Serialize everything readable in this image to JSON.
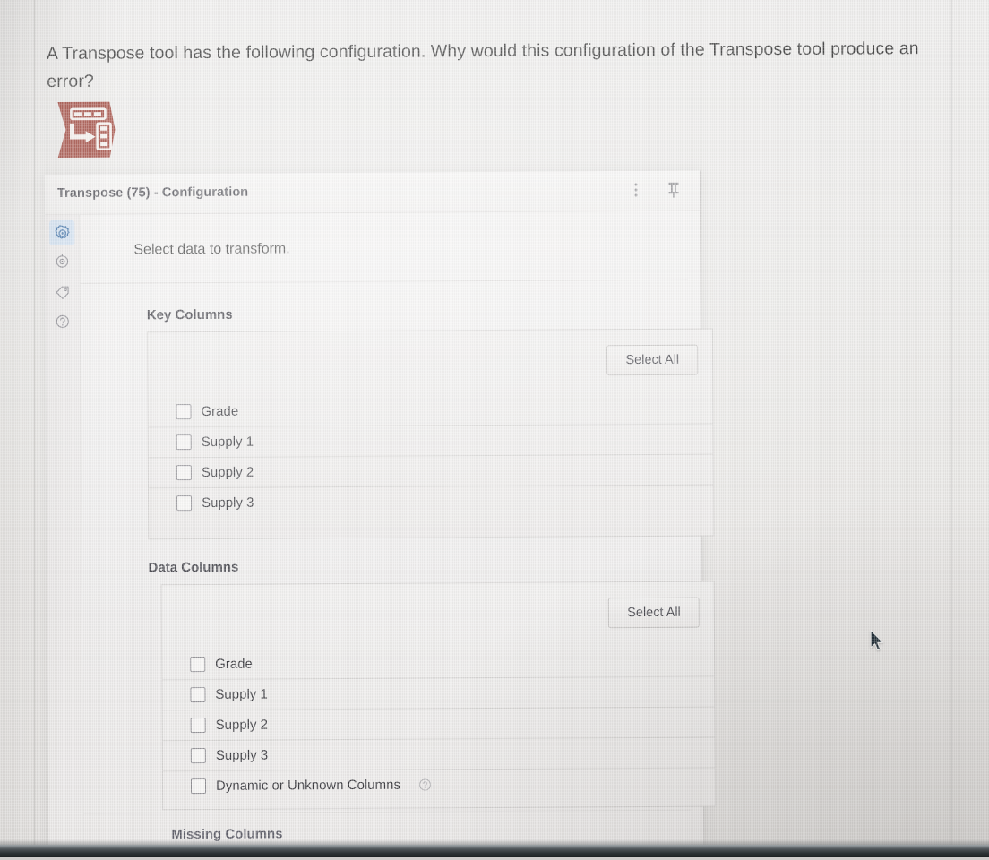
{
  "question": {
    "text": "A Transpose tool has the following configuration. Why would this configuration of the Transpose tool produce an error?"
  },
  "tool_icon": {
    "name": "transpose-tool-icon",
    "color": "#a0463c"
  },
  "panel": {
    "title": "Transpose (75) - Configuration",
    "header_actions": [
      {
        "name": "more-options-icon",
        "label": "⋮"
      },
      {
        "name": "pin-icon",
        "label": "📌"
      }
    ],
    "rail_items": [
      {
        "name": "configuration-gear-icon",
        "label": "Configuration",
        "active": true
      },
      {
        "name": "annotation-target-icon",
        "label": "Annotation",
        "active": false
      },
      {
        "name": "tag-icon",
        "label": "Tag",
        "active": false
      },
      {
        "name": "help-icon",
        "label": "Help",
        "active": false
      }
    ],
    "intro": "Select data to transform.",
    "key_columns": {
      "label": "Key Columns",
      "select_all_label": "Select All",
      "options": [
        {
          "label": "Grade",
          "checked": false
        },
        {
          "label": "Supply 1",
          "checked": false
        },
        {
          "label": "Supply 2",
          "checked": false
        },
        {
          "label": "Supply 3",
          "checked": false
        }
      ]
    },
    "data_columns": {
      "label": "Data Columns",
      "select_all_label": "Select All",
      "options": [
        {
          "label": "Grade",
          "checked": false
        },
        {
          "label": "Supply 1",
          "checked": false
        },
        {
          "label": "Supply 2",
          "checked": false
        },
        {
          "label": "Supply 3",
          "checked": false
        },
        {
          "label": "Dynamic or Unknown Columns",
          "checked": false,
          "help": true
        }
      ]
    },
    "missing_columns": {
      "label": "Missing Columns"
    }
  },
  "colors": {
    "accent_blue": "#3b6fa8",
    "rail_active_bg": "#cfe0f2",
    "tool_red": "#a0463c",
    "panel_bg": "#efeeed",
    "text": "#3a3a3a"
  }
}
